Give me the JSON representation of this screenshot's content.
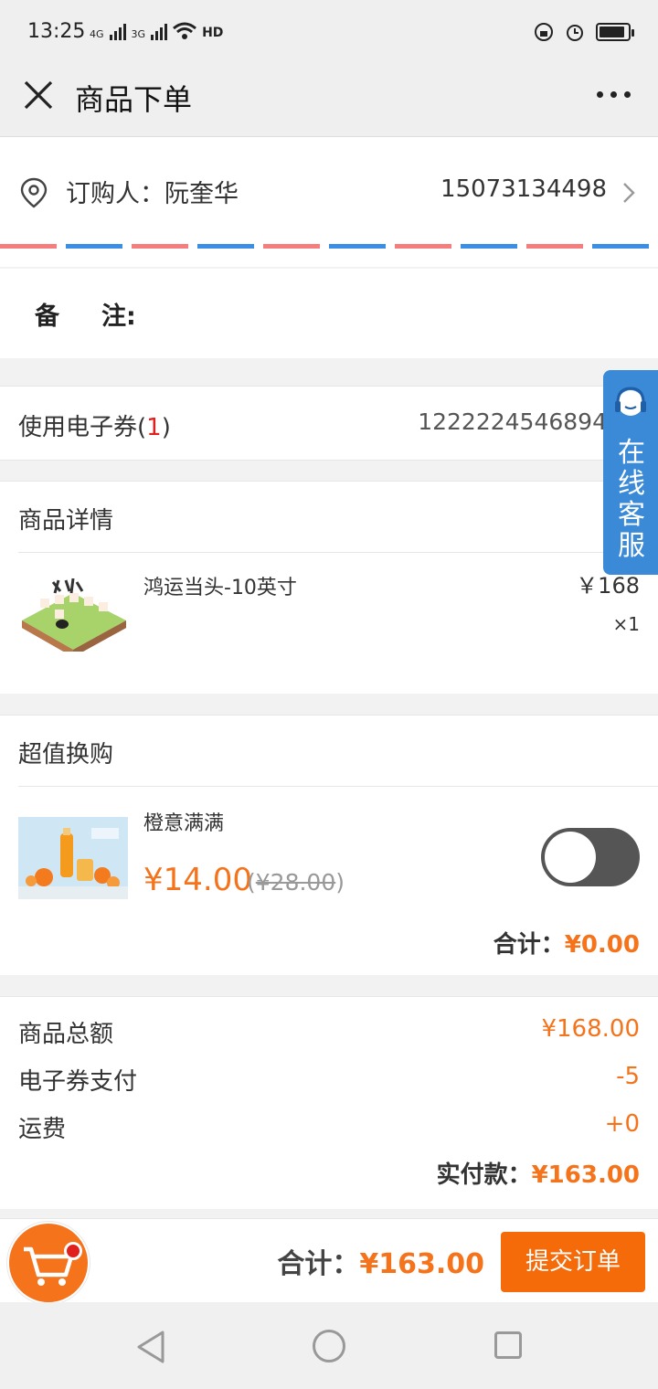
{
  "status": {
    "time": "13:25",
    "net1": "4G",
    "net2": "3G",
    "hd": "HD"
  },
  "header": {
    "title": "商品下单"
  },
  "address": {
    "name_label": "订购人：阮奎华",
    "phone": "15073134498"
  },
  "remark": {
    "label_a": "备",
    "label_b": "注:"
  },
  "coupon": {
    "label": "使用电子券(",
    "count": "1",
    "close": ")",
    "code": "1222224546894"
  },
  "detail": {
    "title": "商品详情",
    "product": {
      "name": "鸿运当头-10英寸",
      "price": "￥168",
      "qty": "×1"
    }
  },
  "exchange": {
    "title": "超值换购",
    "product": {
      "name": "橙意满满",
      "price": "¥14.00",
      "old_open": "(",
      "old_price": "¥28.00",
      "old_close": ")",
      "selected": false
    },
    "total_label": "合计：",
    "total_value": "¥0.00"
  },
  "summary": {
    "rows": [
      {
        "label": "商品总额",
        "value": "¥168.00"
      },
      {
        "label": "电子券支付",
        "value": "-5"
      },
      {
        "label": "运费",
        "value": "+0"
      }
    ],
    "final_label": "实付款：",
    "final_value": "¥163.00"
  },
  "footer": {
    "total_label": "合计：",
    "total_value": "¥163.00",
    "submit": "提交订单"
  },
  "service": {
    "label": "在线客服"
  },
  "colors": {
    "accent": "#f4731b",
    "service": "#3b8ad8",
    "badge": "#e0201d"
  }
}
